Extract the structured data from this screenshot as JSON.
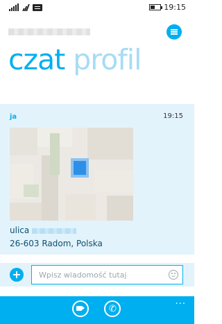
{
  "status_bar": {
    "time": "19:15",
    "icons": [
      "signal-icon",
      "wifi-icon",
      "message-icon",
      "battery-icon"
    ]
  },
  "header": {
    "menu_icon": "hamburger-icon"
  },
  "pivot": {
    "tabs": [
      {
        "label": "czat",
        "active": true
      },
      {
        "label": "profil",
        "active": false
      }
    ]
  },
  "conversation": {
    "sender": "ja",
    "time": "19:15",
    "address_line1_prefix": "ulica",
    "address_line2": "26-603 Radom, Polska"
  },
  "composer": {
    "placeholder": "Wpisz wiadomość tutaj",
    "attach_icon": "plus-icon",
    "emoji_icon": "smiley-icon"
  },
  "appbar": {
    "buttons": [
      "video-call-icon",
      "voice-call-icon"
    ],
    "more": "..."
  },
  "colors": {
    "accent": "#00aff0",
    "inactive_tab": "#a7dcf3",
    "conversation_bg": "#e3f3fc"
  }
}
